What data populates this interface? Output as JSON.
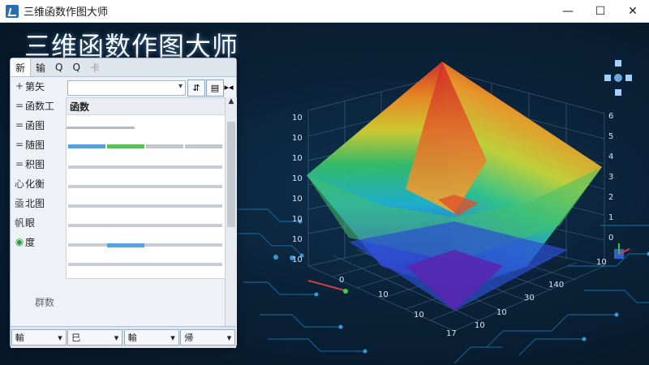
{
  "window": {
    "title": "三维函数作图大师",
    "min_icon": "minimize-icon",
    "max_icon": "maximize-icon",
    "close_icon": "close-icon"
  },
  "heading": "三维函数作图大师",
  "panel": {
    "tabs": [
      "新",
      "输",
      "Q",
      "Q",
      "卡"
    ],
    "side_items": [
      {
        "prefix": "+",
        "label": "第矢"
      },
      {
        "prefix": "=",
        "label": "函数工"
      },
      {
        "prefix": "=",
        "label": "函图"
      },
      {
        "prefix": "=",
        "label": "随图"
      },
      {
        "prefix": "=",
        "label": "积图"
      },
      {
        "prefix": "心",
        "label": "化衡"
      },
      {
        "prefix": "亟",
        "label": "北图"
      },
      {
        "prefix": "帆",
        "label": "眼"
      },
      {
        "prefix": "◉",
        "label": "度"
      }
    ],
    "param_label": "群数",
    "sheet_header": "函数",
    "footer_buttons": [
      "輸",
      "巳",
      "輸",
      "帰"
    ]
  },
  "axes": {
    "left_ticks": [
      "10",
      "10",
      "10",
      "10",
      "10",
      "10",
      "10",
      "10"
    ],
    "right_ticks": [
      "6",
      "5",
      "4",
      "3",
      "2",
      "1",
      "0"
    ],
    "bottom_left_ticks": [
      "0",
      "10",
      "10",
      "17"
    ],
    "bottom_right_ticks": [
      "10",
      "140",
      "30",
      "10",
      "10"
    ]
  },
  "colors": {
    "heading": "#ffffff",
    "background": "#0a2238"
  }
}
